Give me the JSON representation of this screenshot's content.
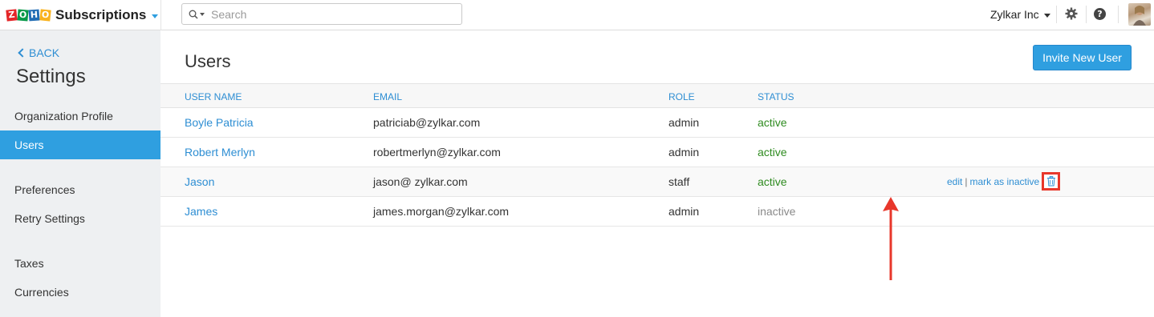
{
  "brand": {
    "logo_letters": [
      "Z",
      "O",
      "H",
      "O"
    ],
    "product": "Subscriptions"
  },
  "search": {
    "placeholder": "Search"
  },
  "header": {
    "org_name": "Zylkar Inc"
  },
  "sidebar": {
    "back_label": "BACK",
    "title": "Settings",
    "items": [
      {
        "label": "Organization Profile",
        "active": false
      },
      {
        "label": "Users",
        "active": true
      },
      {
        "label": "Preferences",
        "active": false
      },
      {
        "label": "Retry Settings",
        "active": false
      },
      {
        "label": "Taxes",
        "active": false
      },
      {
        "label": "Currencies",
        "active": false
      }
    ]
  },
  "main": {
    "title": "Users",
    "invite_button": "Invite New User",
    "columns": [
      "USER NAME",
      "EMAIL",
      "ROLE",
      "STATUS"
    ],
    "rows": [
      {
        "name": "Boyle Patricia",
        "email": "patriciab@zylkar.com",
        "role": "admin",
        "status": "active"
      },
      {
        "name": "Robert Merlyn",
        "email": "robertmerlyn@zylkar.com",
        "role": "admin",
        "status": "active"
      },
      {
        "name": "Jason",
        "email": "jason@ zylkar.com",
        "role": "staff",
        "status": "active"
      },
      {
        "name": "James",
        "email": "james.morgan@zylkar.com",
        "role": "admin",
        "status": "inactive"
      }
    ],
    "row_actions": {
      "edit": "edit",
      "separator": "|",
      "mark_inactive": "mark as inactive"
    }
  },
  "colors": {
    "accent": "#2f9fe0",
    "link": "#2e8ed3",
    "status_active": "#2e8b1f",
    "status_inactive": "#8a8a8a",
    "highlight": "#e8372b"
  },
  "icons": [
    "search-icon",
    "gear-icon",
    "help-icon",
    "avatar",
    "trash-icon",
    "chevron-left-icon",
    "annotation-arrow"
  ]
}
